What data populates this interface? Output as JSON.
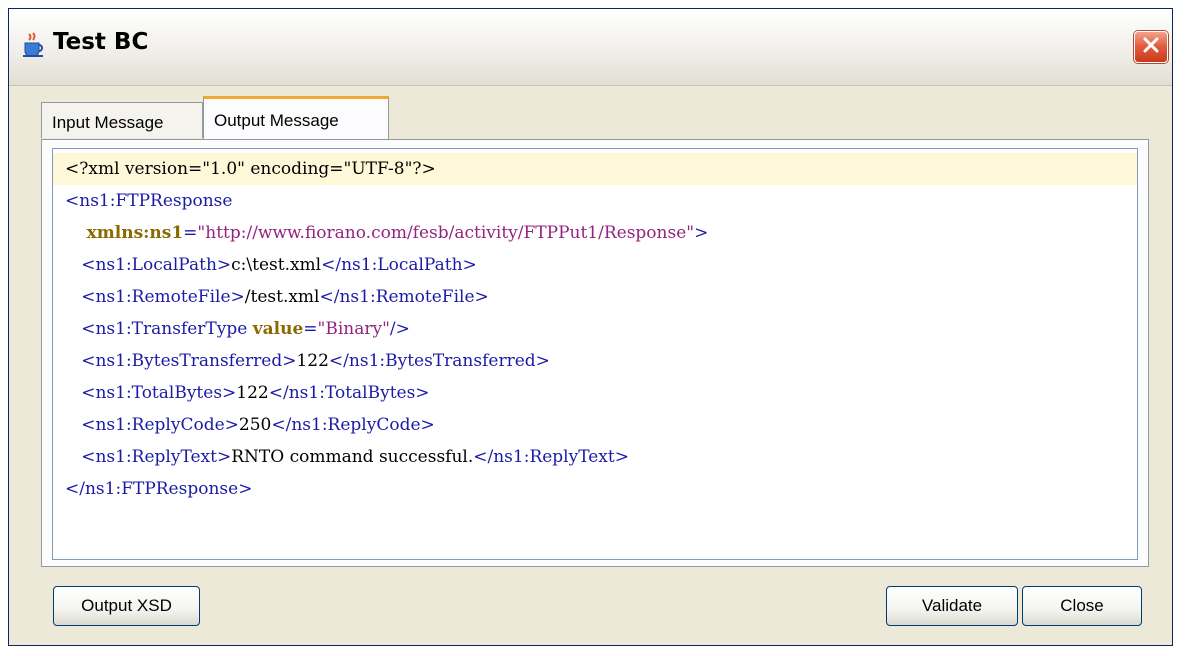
{
  "window": {
    "title": "Test BC",
    "app_icon": "java-cup-icon",
    "close_icon": "close-icon"
  },
  "tabs": [
    {
      "label": "Input Message",
      "selected": false
    },
    {
      "label": "Output Message",
      "selected": true
    }
  ],
  "editor": {
    "lines": [
      [
        {
          "t": "<?xml version=\"1.0\" encoding=\"UTF-8\"?>",
          "c": "txt"
        }
      ],
      [
        {
          "t": "<ns1:FTPResponse",
          "c": "tag"
        }
      ],
      [
        {
          "t": "    ",
          "c": "txt"
        },
        {
          "t": "xmlns:ns1",
          "c": "attr"
        },
        {
          "t": "=",
          "c": "tag"
        },
        {
          "t": "\"http://www.fiorano.com/fesb/activity/FTPPut1/Response\"",
          "c": "val"
        },
        {
          "t": ">",
          "c": "tag"
        }
      ],
      [
        {
          "t": "   ",
          "c": "txt"
        },
        {
          "t": "<ns1:LocalPath>",
          "c": "tag"
        },
        {
          "t": "c:\\test.xml",
          "c": "txt"
        },
        {
          "t": "</ns1:LocalPath>",
          "c": "tag"
        }
      ],
      [
        {
          "t": "   ",
          "c": "txt"
        },
        {
          "t": "<ns1:RemoteFile>",
          "c": "tag"
        },
        {
          "t": "/test.xml",
          "c": "txt"
        },
        {
          "t": "</ns1:RemoteFile>",
          "c": "tag"
        }
      ],
      [
        {
          "t": "   ",
          "c": "txt"
        },
        {
          "t": "<ns1:TransferType ",
          "c": "tag"
        },
        {
          "t": "value",
          "c": "attr"
        },
        {
          "t": "=",
          "c": "tag"
        },
        {
          "t": "\"Binary\"",
          "c": "val"
        },
        {
          "t": "/>",
          "c": "tag"
        }
      ],
      [
        {
          "t": "   ",
          "c": "txt"
        },
        {
          "t": "<ns1:BytesTransferred>",
          "c": "tag"
        },
        {
          "t": "122",
          "c": "txt"
        },
        {
          "t": "</ns1:BytesTransferred>",
          "c": "tag"
        }
      ],
      [
        {
          "t": "   ",
          "c": "txt"
        },
        {
          "t": "<ns1:TotalBytes>",
          "c": "tag"
        },
        {
          "t": "122",
          "c": "txt"
        },
        {
          "t": "</ns1:TotalBytes>",
          "c": "tag"
        }
      ],
      [
        {
          "t": "   ",
          "c": "txt"
        },
        {
          "t": "<ns1:ReplyCode>",
          "c": "tag"
        },
        {
          "t": "250",
          "c": "txt"
        },
        {
          "t": "</ns1:ReplyCode>",
          "c": "tag"
        }
      ],
      [
        {
          "t": "   ",
          "c": "txt"
        },
        {
          "t": "<ns1:ReplyText>",
          "c": "tag"
        },
        {
          "t": "RNTO command successful.",
          "c": "txt"
        },
        {
          "t": "</ns1:ReplyText>",
          "c": "tag"
        }
      ],
      [
        {
          "t": "</ns1:FTPResponse>",
          "c": "tag"
        }
      ]
    ]
  },
  "buttons": {
    "output_xsd": "Output XSD",
    "validate": "Validate",
    "close": "Close"
  },
  "colors": {
    "tag": "#1a1aa6",
    "attr": "#8b6a00",
    "value": "#93237f",
    "text": "#000000",
    "current_line": "#fff8d8",
    "active_tab_accent": "#f0a830",
    "close_button": "#e2593b"
  }
}
